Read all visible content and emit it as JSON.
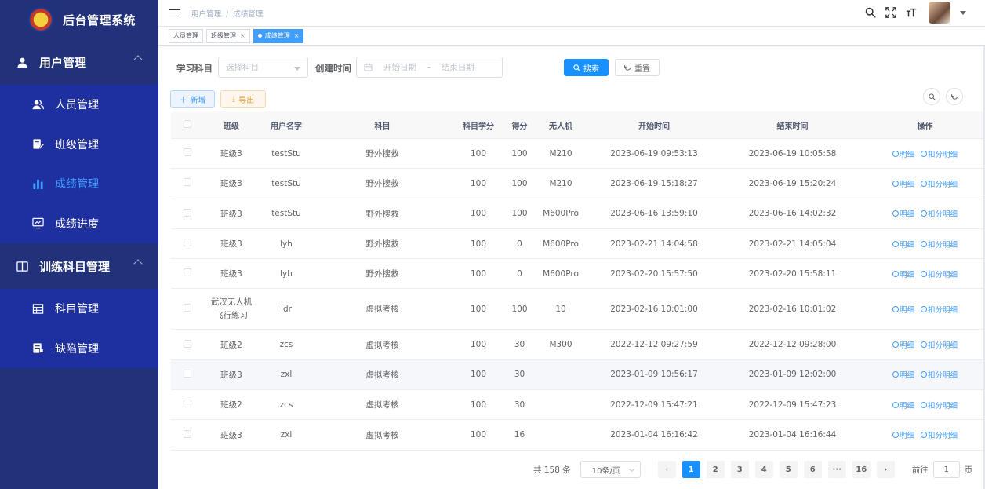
{
  "brand": {
    "title": "后台管理系统"
  },
  "sidebar": {
    "groups": [
      {
        "label": "用户管理",
        "items": [
          {
            "label": "人员管理"
          },
          {
            "label": "班级管理"
          },
          {
            "label": "成绩管理"
          },
          {
            "label": "成绩进度"
          }
        ]
      },
      {
        "label": "训练科目管理",
        "items": [
          {
            "label": "科目管理"
          },
          {
            "label": "缺陷管理"
          }
        ]
      }
    ]
  },
  "breadcrumb": [
    "用户管理",
    "成绩管理"
  ],
  "tags": [
    {
      "label": "人员管理"
    },
    {
      "label": "班级管理"
    },
    {
      "label": "成绩管理"
    }
  ],
  "search": {
    "subject_label": "学习科目",
    "subject_placeholder": "选择科目",
    "time_label": "创建时间",
    "start_placeholder": "开始日期",
    "range_sep": "-",
    "end_placeholder": "结束日期",
    "search_btn": "搜索",
    "reset_btn": "重置"
  },
  "toolbar": {
    "add_btn": "新增",
    "export_btn": "导出"
  },
  "table": {
    "headers": [
      "班级",
      "用户名字",
      "科目",
      "科目学分",
      "得分",
      "无人机",
      "开始时间",
      "结束时间",
      "操作"
    ],
    "op_detail": "明细",
    "op_deduct": "扣分明细",
    "rows": [
      [
        "班级3",
        "testStu",
        "野外搜救",
        "100",
        "100",
        "M210",
        "2023-06-19 09:53:13",
        "2023-06-19 10:05:58"
      ],
      [
        "班级3",
        "testStu",
        "野外搜救",
        "100",
        "100",
        "M210",
        "2023-06-19 15:18:27",
        "2023-06-19 15:20:24"
      ],
      [
        "班级3",
        "testStu",
        "野外搜救",
        "100",
        "100",
        "M600Pro",
        "2023-06-16 13:59:10",
        "2023-06-16 14:02:32"
      ],
      [
        "班级3",
        "lyh",
        "野外搜救",
        "100",
        "0",
        "M600Pro",
        "2023-02-21 14:04:58",
        "2023-02-21 14:05:04"
      ],
      [
        "班级3",
        "lyh",
        "野外搜救",
        "100",
        "0",
        "M600Pro",
        "2023-02-20 15:57:50",
        "2023-02-20 15:58:11"
      ],
      [
        "武汉无人机飞行练习",
        "ldr",
        "虚拟考核",
        "100",
        "100",
        "10",
        "2023-02-16 10:01:00",
        "2023-02-16 10:01:02"
      ],
      [
        "班级2",
        "zcs",
        "虚拟考核",
        "100",
        "30",
        "M300",
        "2022-12-12 09:27:59",
        "2022-12-12 09:28:00"
      ],
      [
        "班级3",
        "zxl",
        "虚拟考核",
        "100",
        "30",
        "",
        "2023-01-09 10:56:17",
        "2023-01-09 12:02:00"
      ],
      [
        "班级2",
        "zcs",
        "虚拟考核",
        "100",
        "30",
        "",
        "2022-12-09 15:47:21",
        "2022-12-09 15:47:23"
      ],
      [
        "班级3",
        "zxl",
        "虚拟考核",
        "100",
        "16",
        "",
        "2023-01-04 16:16:42",
        "2023-01-04 16:16:44"
      ]
    ]
  },
  "pagination": {
    "total_text": "共 158 条",
    "page_size": "10条/页",
    "pages": [
      "1",
      "2",
      "3",
      "4",
      "5",
      "6",
      "···",
      "16"
    ],
    "current": "1",
    "goto_label": "前往",
    "goto_value": "1",
    "page_unit": "页"
  },
  "colors": {
    "sidebar_bg": "#22327a",
    "submenu_bg": "#1e2f9f",
    "primary": "#1890ff",
    "link": "#409eff"
  }
}
